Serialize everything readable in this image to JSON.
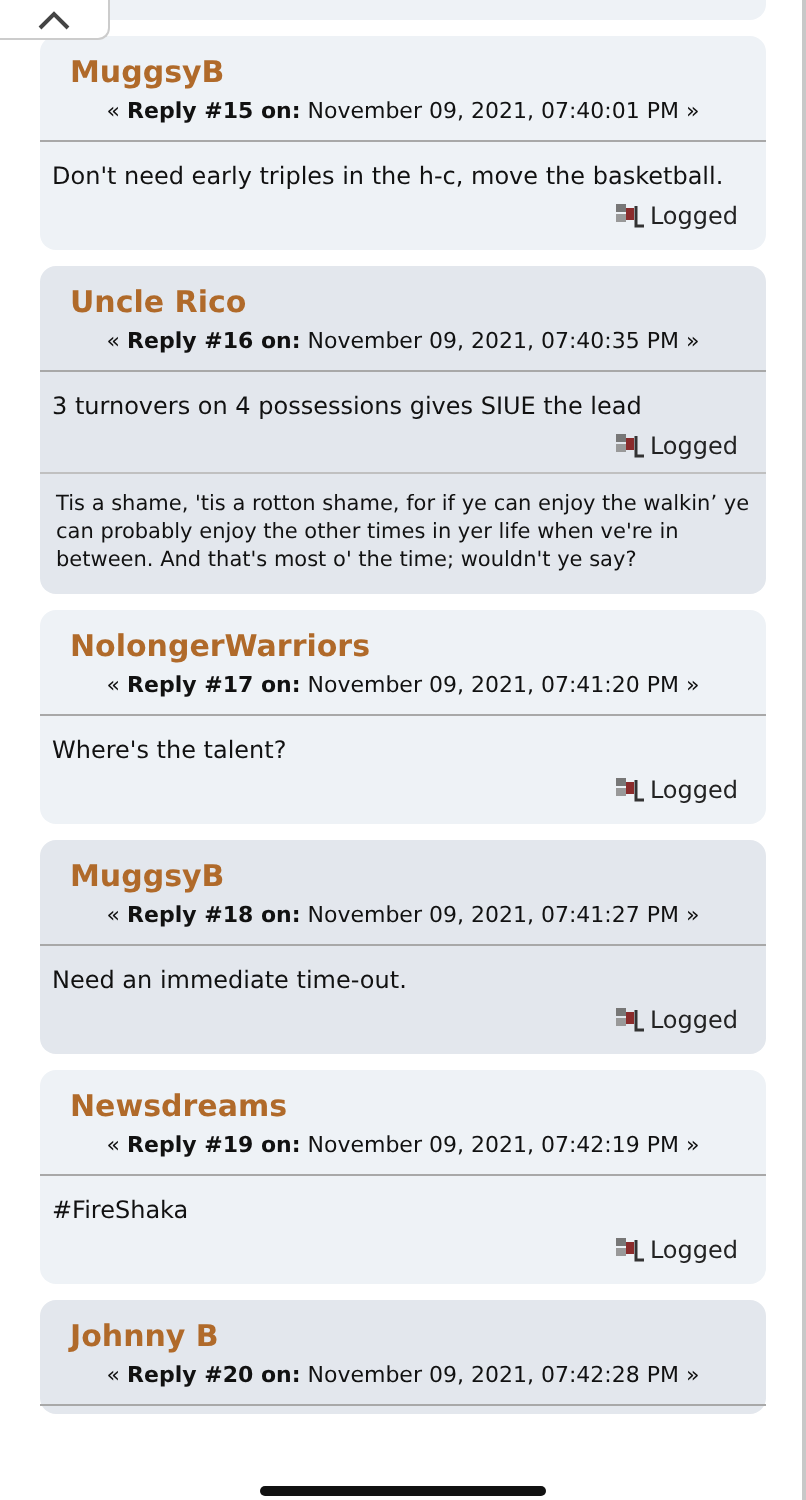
{
  "posts": [
    {
      "author": "MuggsyB",
      "header": "« **Reply #15 on:** November 09, 2021, 07:40:01 PM »",
      "body": "Don't need early triples in the h-c, move the basketball.",
      "status": "Logged"
    },
    {
      "author": "Uncle Rico",
      "header": "« **Reply #16 on:** November 09, 2021, 07:40:35 PM »",
      "body": "3 turnovers on 4 possessions gives SIUE the lead",
      "status": "Logged",
      "signature": "Tis a shame, 'tis a rotton shame, for if ye can enjoy the walkin’ ye can probably enjoy the other times in yer life when ve're in between. And that's most o' the time; wouldn't ye say?"
    },
    {
      "author": "NolongerWarriors",
      "header": "« **Reply #17 on:** November 09, 2021, 07:41:20 PM »",
      "body": "Where's the talent?",
      "status": "Logged"
    },
    {
      "author": "MuggsyB",
      "header": "« **Reply #18 on:** November 09, 2021, 07:41:27 PM »",
      "body": "Need an immediate time-out.",
      "status": "Logged"
    },
    {
      "author": "Newsdreams",
      "header": "« **Reply #19 on:** November 09, 2021, 07:42:19 PM »",
      "body": "#FireShaka",
      "status": "Logged"
    },
    {
      "author": "Johnny B",
      "header": "« **Reply #20 on:** November 09, 2021, 07:42:28 PM »"
    }
  ]
}
